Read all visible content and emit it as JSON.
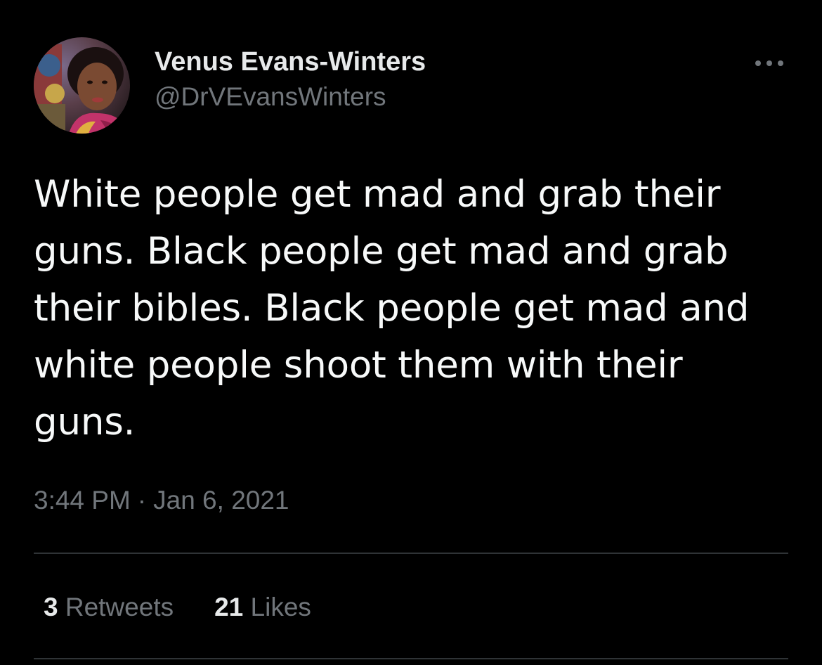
{
  "tweet": {
    "author": {
      "display_name": "Venus Evans-Winters",
      "handle": "@DrVEvansWinters",
      "avatar_icon": "profile-photo"
    },
    "more_icon": "more-horizontal-icon",
    "text": "White people get mad and grab their guns. Black people get mad and grab their bibles. Black people get mad and white people shoot them with their guns.",
    "time": "3:44 PM",
    "separator": "·",
    "date": "Jan 6, 2021",
    "stats": {
      "retweets_count": "3",
      "retweets_label": "Retweets",
      "likes_count": "21",
      "likes_label": "Likes"
    }
  },
  "colors": {
    "background": "#000000",
    "primary_text": "#e7e9ea",
    "secondary_text": "#71767b",
    "divider": "#2f3336"
  }
}
